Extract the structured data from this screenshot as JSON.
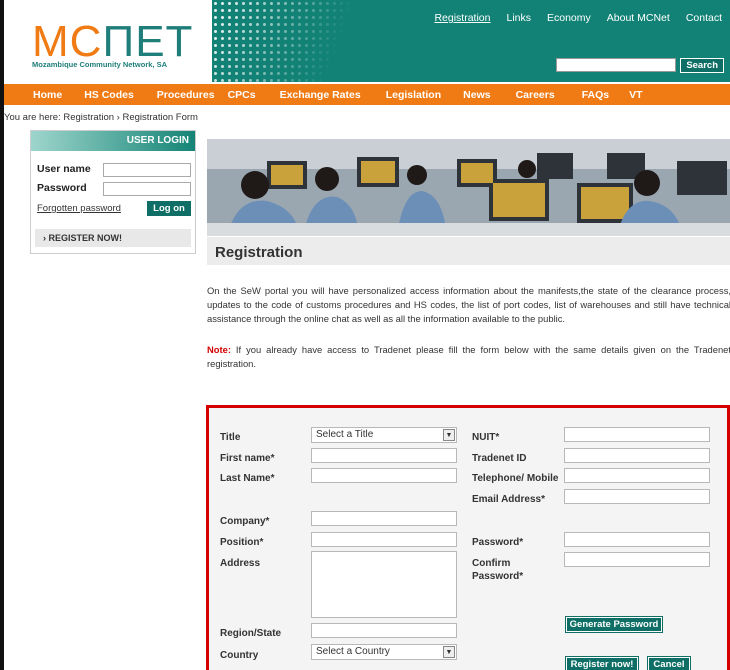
{
  "brand": {
    "logo_main": "MC",
    "logo_accent": "ΠET",
    "logo_sub": "Mozambique Community Network, SA",
    "accent": "#f07b15",
    "teal": "#128276"
  },
  "toplinks": [
    "Registration",
    "Links",
    "Economy",
    "About MCNet",
    "Contact"
  ],
  "search": {
    "placeholder": "",
    "button": "Search"
  },
  "nav": [
    "Home",
    "HS Codes",
    "Procedures",
    "CPCs",
    "Exchange Rates",
    "Legislation",
    "News",
    "Careers",
    "FAQs",
    "VT"
  ],
  "breadcrumb": "You are here: Registration › Registration Form",
  "login": {
    "title": "USER LOGIN",
    "username_label": "User name",
    "password_label": "Password",
    "forgot": "Forgotten password",
    "logon": "Log on",
    "register": "› REGISTER NOW!"
  },
  "page": {
    "title": "Registration",
    "intro": "On the SeW portal you will have personalized access information about the manifests,the state of the clearance process, updates to the code of customs procedures and HS codes, the list of port codes, list of warehouses and still have technical assistance through the online chat as well as all the information available to the public.",
    "note_label": "Note:",
    "note_text": " If you already have access to Tradenet please fill the form below with the same details given on the Tradenet registration."
  },
  "form": {
    "title_label": "Title",
    "title_value": "Select a Title",
    "first_name": "First name*",
    "last_name": "Last Name*",
    "company": "Company*",
    "position": "Position*",
    "address": "Address",
    "region": "Region/State",
    "country_label": "Country",
    "country_value": "Select a Country",
    "nuit": "NUIT*",
    "tradenet": "Tradenet ID",
    "telephone": "Telephone/ Mobile",
    "email": "Email Address*",
    "password": "Password*",
    "confirm_password": "Confirm Password*",
    "generate": "Generate Password",
    "register": "Register now!",
    "cancel": "Cancel"
  }
}
